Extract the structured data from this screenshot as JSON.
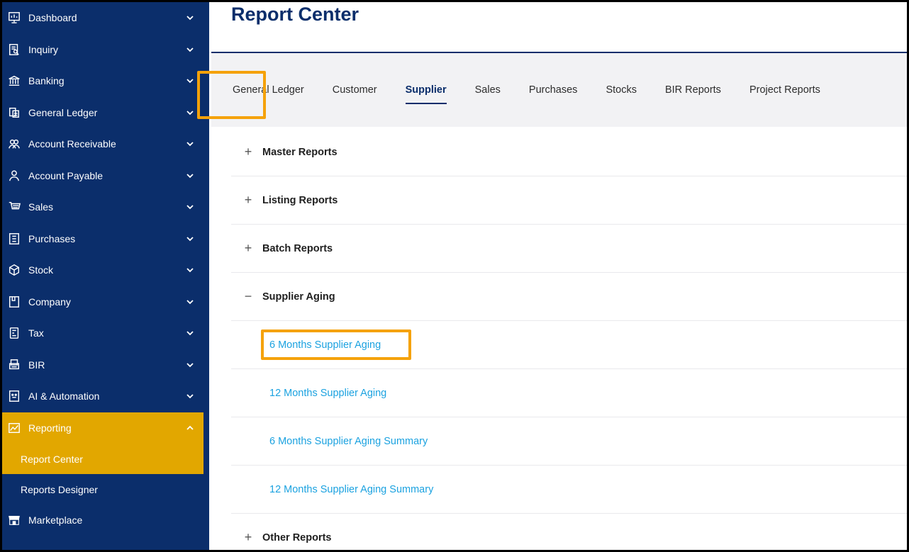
{
  "sidebar": {
    "items": [
      {
        "label": "Dashboard",
        "icon": "dashboard-icon"
      },
      {
        "label": "Inquiry",
        "icon": "inquiry-icon"
      },
      {
        "label": "Banking",
        "icon": "bank-icon"
      },
      {
        "label": "General Ledger",
        "icon": "ledger-icon"
      },
      {
        "label": "Account Receivable",
        "icon": "receivable-icon"
      },
      {
        "label": "Account Payable",
        "icon": "payable-icon"
      },
      {
        "label": "Sales",
        "icon": "sales-icon"
      },
      {
        "label": "Purchases",
        "icon": "purchases-icon"
      },
      {
        "label": "Stock",
        "icon": "stock-icon"
      },
      {
        "label": "Company",
        "icon": "company-icon"
      },
      {
        "label": "Tax",
        "icon": "tax-icon"
      },
      {
        "label": "BIR",
        "icon": "bir-icon"
      },
      {
        "label": "AI & Automation",
        "icon": "ai-icon"
      },
      {
        "label": "Reporting",
        "icon": "reporting-icon"
      }
    ],
    "sub_items": [
      {
        "label": "Report Center"
      },
      {
        "label": "Reports Designer"
      }
    ],
    "marketplace": {
      "label": "Marketplace",
      "icon": "marketplace-icon"
    }
  },
  "page": {
    "title": "Report Center"
  },
  "tabs": [
    {
      "label": "General Ledger"
    },
    {
      "label": "Customer"
    },
    {
      "label": "Supplier"
    },
    {
      "label": "Sales"
    },
    {
      "label": "Purchases"
    },
    {
      "label": "Stocks"
    },
    {
      "label": "BIR Reports"
    },
    {
      "label": "Project Reports"
    }
  ],
  "sections": [
    {
      "label": "Master Reports"
    },
    {
      "label": "Listing Reports"
    },
    {
      "label": "Batch Reports"
    },
    {
      "label": "Supplier Aging"
    },
    {
      "label": "Other Reports"
    }
  ],
  "supplier_aging_links": [
    {
      "label": "6 Months Supplier Aging"
    },
    {
      "label": "12 Months Supplier Aging"
    },
    {
      "label": "6 Months Supplier Aging Summary"
    },
    {
      "label": "12 Months Supplier Aging Summary"
    }
  ],
  "colors": {
    "sidebar_bg": "#0b2e6b",
    "active_bg": "#e2a700",
    "highlight": "#f5a20a",
    "link": "#1ba2e0",
    "title": "#0b2e6b"
  }
}
